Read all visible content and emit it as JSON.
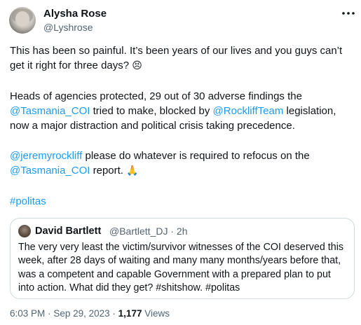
{
  "author": {
    "name": "Alysha Rose",
    "handle": "@Lyshrose"
  },
  "tweet": {
    "p1_text": "This has been so painful. It’s been years of our lives and you guys can’t get it right for three days?",
    "p1_emoji": "😣",
    "p2_a": "Heads of agencies protected, 29 out of 30 adverse findings the",
    "p2_link1": "@Tasmania_COI",
    "p2_b": "tried to make, blocked by",
    "p2_link2": "@RockliffTeam",
    "p2_c": "legislation, now a major distraction and political crisis taking precedence.",
    "p3_link1": "@jeremyrockliff",
    "p3_a": "please do whatever is required to refocus on the",
    "p3_link2": "@Tasmania_COI",
    "p3_b": "report.",
    "p3_emoji": "🙏",
    "hashtag": "#politas"
  },
  "quoted": {
    "name": "David Bartlett",
    "handle": "@Bartlett_DJ",
    "separator": "·",
    "time": "2h",
    "text": "The very very least the victim/survivor witnesses of the COI deserved this week, after 28 days of waiting and many many months/years before that, was a competent and capable Government with a prepared plan to put into action. What did they get? #shitshow. #politas"
  },
  "footer": {
    "time": "6:03 PM",
    "separator": "·",
    "date": "Sep 29, 2023",
    "views_count": "1,177",
    "views_label": "Views"
  },
  "icons": {
    "more": "more-horizontal-icon"
  },
  "colors": {
    "link": "#1d9bf0",
    "secondary_text": "#536471",
    "primary_text": "#0f1419",
    "border": "#cfd9de"
  }
}
